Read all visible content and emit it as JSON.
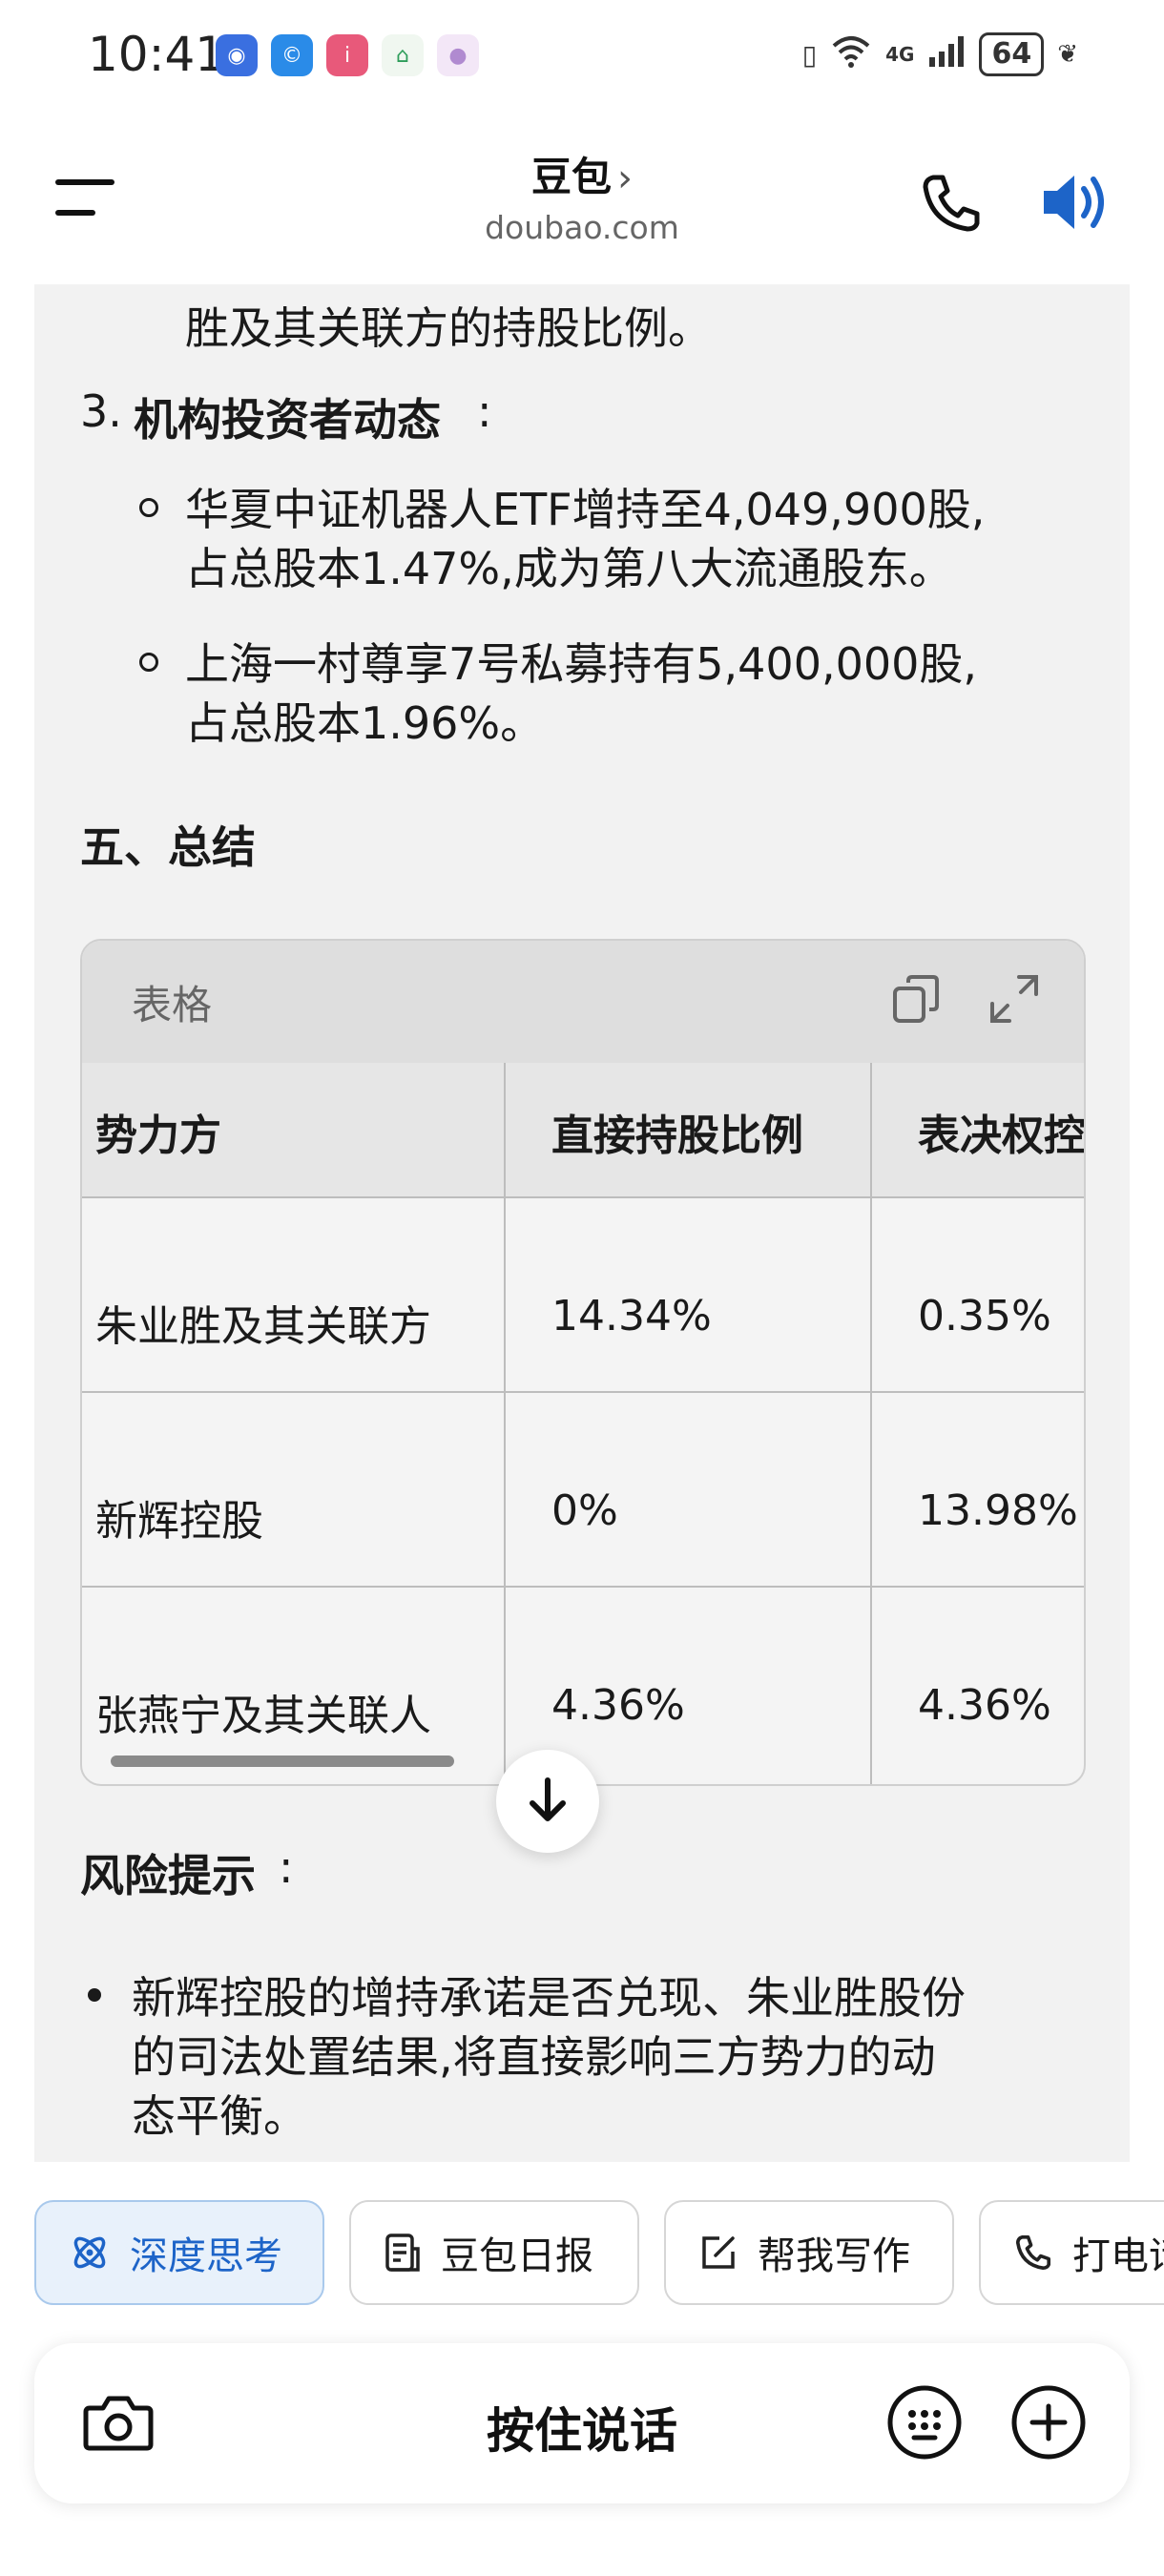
{
  "status_bar": {
    "time": "10:41",
    "network": "4G",
    "battery": "64"
  },
  "header": {
    "title": "豆包",
    "subtitle": "doubao.com"
  },
  "content": {
    "cont_line": "胜及其关联方的持股比例。",
    "item3_num": "3.",
    "item3_title": "机构投资者动态",
    "item3_colon": ":",
    "bullets": [
      {
        "line1": "华夏中证机器人ETF增持至4,049,900股,",
        "line2": "占总股本1.47%,成为第八大流通股东。"
      },
      {
        "line1": "上海一村尊享7号私募持有5,400,000股,",
        "line2": "占总股本1.96%。"
      }
    ],
    "section_title": "五、总结",
    "risk_title": "风险提示",
    "risk_colon": ":",
    "risk_line1": "新辉控股的增持承诺是否兑现、朱业胜股份",
    "risk_line2": "的司法处置结果,将直接影响三方势力的动",
    "risk_line3": "态平衡。"
  },
  "table": {
    "label": "表格",
    "headers": [
      "势力方",
      "直接持股比例",
      "表决权控"
    ],
    "rows": [
      [
        "朱业胜及其关联方",
        "14.34%",
        "0.35%"
      ],
      [
        "新辉控股",
        "0%",
        "13.98%"
      ],
      [
        "张燕宁及其关联人",
        "4.36%",
        "4.36%"
      ]
    ]
  },
  "chips": [
    "深度思考",
    "豆包日报",
    "帮我写作",
    "打电话"
  ],
  "input": {
    "hold_to_talk": "按住说话"
  },
  "colors": {
    "accent": "#1d64c8",
    "content_bg": "#f2f2f2"
  }
}
